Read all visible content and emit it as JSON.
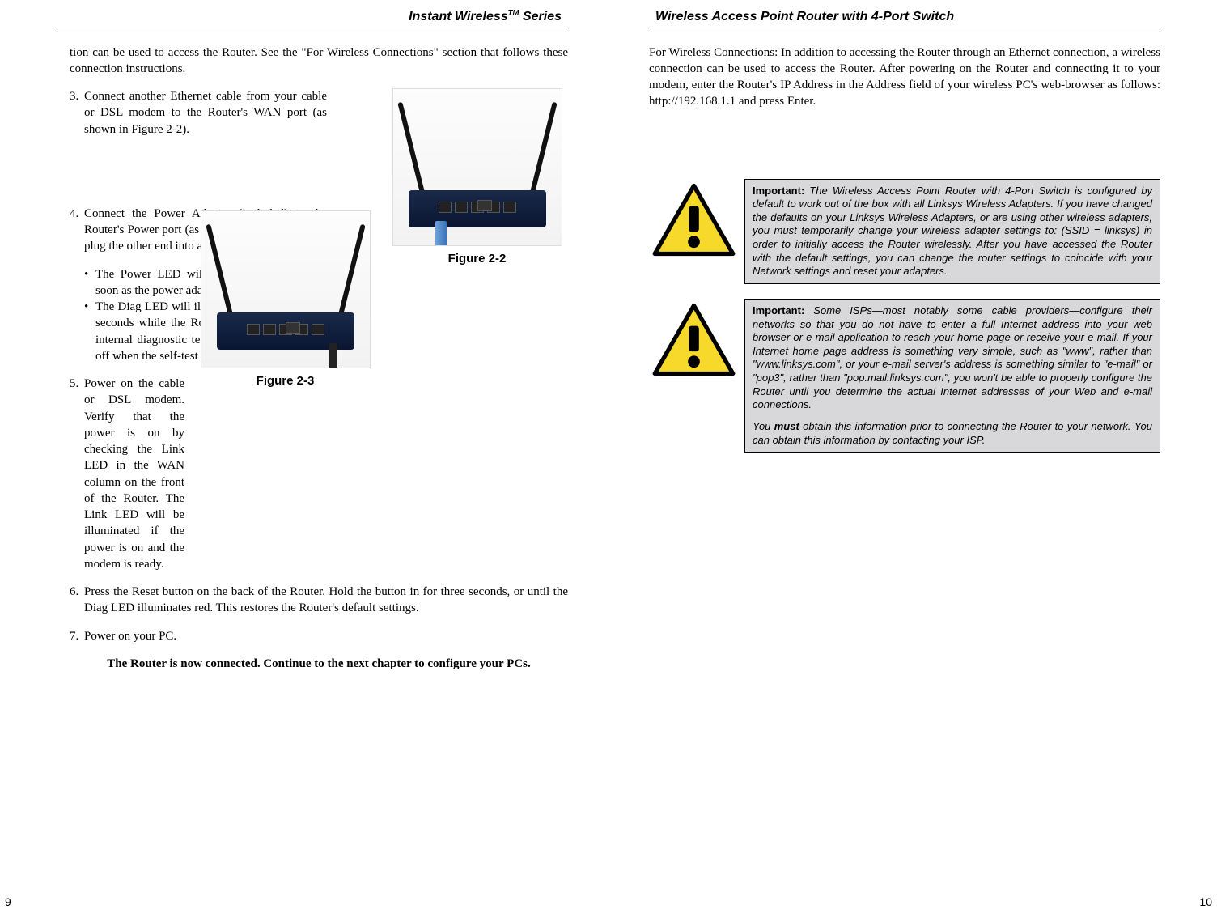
{
  "left": {
    "header_pre": "Instant Wireless",
    "header_tm": "TM",
    "header_post": " Series",
    "cont": "tion can be used to access the Router. See the \"For Wireless Connections\" section that follows these connection instructions.",
    "step3_num": "3.",
    "step3": "Connect another Ethernet cable from your cable or DSL modem to the Router's WAN port (as shown in Figure 2-2).",
    "fig22": "Figure 2-2",
    "step4_num": "4.",
    "step4": "Connect the Power Adapter (included) to the Router's Power port (as shown in Figure 2-3) and plug the other end into a power outlet.",
    "bullet1": "The Power LED will illuminate green as soon as the power adapter is connected.",
    "bullet2": "The Diag LED will illuminate red for a few seconds while the Router goes through its internal diagnostic test. The LED will turn off when the self-test is complete.",
    "fig23": "Figure 2-3",
    "step5_num": "5.",
    "step5": "Power on the cable or DSL modem.  Verify that the power is on by checking the Link LED in the WAN column on the front of the Router.  The Link LED will be illuminated if the power is on and the modem is ready.",
    "step6_num": "6.",
    "step6": "Press the Reset button on the back of the Router. Hold the button in for three seconds, or until the Diag LED illuminates red. This restores the Router's default settings.",
    "step7_num": "7.",
    "step7": "Power on your PC.",
    "final": "The Router is now connected. Continue to the next chapter to configure your PCs.",
    "pagenum": "9"
  },
  "right": {
    "header": "Wireless Access Point Router with 4-Port Switch",
    "para": "For Wireless Connections:   In addition to accessing the Router through an Ethernet connection, a wireless connection can be used to access the Router. After powering on the Router and connecting it to your modem, enter the Router's IP Address in the Address field of your wireless PC's web-browser as follows: http://192.168.1.1 and press Enter.",
    "imp_label": "Important:",
    "imp1": " The Wireless Access Point Router with 4-Port Switch is configured by default to work out of the box with all Linksys Wireless Adapters. If you have changed the defaults on your Linksys Wireless Adapters, or are using other wireless adapters, you must temporarily change your wireless adapter settings to: (SSID = linksys) in order to initially access the Router wirelessly. After you have accessed the Router with the default settings, you can change the router settings to coincide with your Network settings and reset your adapters.",
    "imp2a": " Some ISPs—most notably some cable providers—configure their networks so that you do not have to enter a full Internet address into your web browser or e-mail application to reach your home page or receive your e-mail. If your Internet home page address is something very simple, such as \"www\", rather than \"www.linksys.com\", or your e-mail server's address is something similar to \"e-mail\" or \"pop3\", rather than \"pop.mail.linksys.com\", you won't be able to properly configure the Router until you determine the actual Internet addresses of your Web and e-mail connections.",
    "imp2b_pre": "You ",
    "imp2b_must": "must",
    "imp2b_post": " obtain this information prior to connecting the Router to your network. You can obtain this information by contacting your ISP.",
    "pagenum": "10"
  }
}
